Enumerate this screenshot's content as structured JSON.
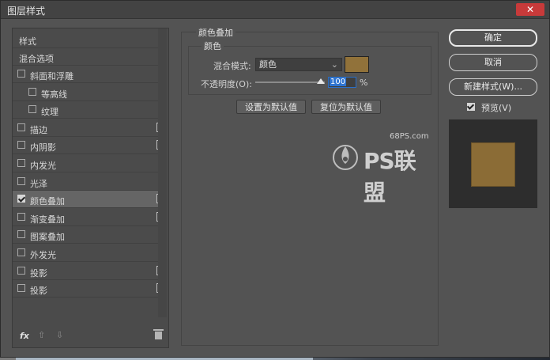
{
  "window": {
    "title": "图层样式",
    "close_glyph": "✕"
  },
  "styles_list": {
    "header": "样式",
    "blend_options": "混合选项",
    "items": [
      {
        "label": "斜面和浮雕",
        "checked": false,
        "indent": false,
        "plus": false
      },
      {
        "label": "等高线",
        "checked": false,
        "indent": true,
        "plus": false
      },
      {
        "label": "纹理",
        "checked": false,
        "indent": true,
        "plus": false
      },
      {
        "label": "描边",
        "checked": false,
        "indent": false,
        "plus": true
      },
      {
        "label": "内阴影",
        "checked": false,
        "indent": false,
        "plus": true
      },
      {
        "label": "内发光",
        "checked": false,
        "indent": false,
        "plus": false
      },
      {
        "label": "光泽",
        "checked": false,
        "indent": false,
        "plus": false
      },
      {
        "label": "颜色叠加",
        "checked": true,
        "indent": false,
        "plus": true,
        "selected": true
      },
      {
        "label": "渐变叠加",
        "checked": false,
        "indent": false,
        "plus": true
      },
      {
        "label": "图案叠加",
        "checked": false,
        "indent": false,
        "plus": false
      },
      {
        "label": "外发光",
        "checked": false,
        "indent": false,
        "plus": false
      },
      {
        "label": "投影",
        "checked": false,
        "indent": false,
        "plus": true
      },
      {
        "label": "投影",
        "checked": false,
        "indent": false,
        "plus": true
      }
    ],
    "fx_label": "fx",
    "up_arrow": "⇧",
    "down_arrow": "⇩"
  },
  "panel": {
    "group_title": "颜色叠加",
    "sub_title": "颜色",
    "blend_mode_label": "混合模式:",
    "blend_mode_value": "颜色",
    "overlay_color": "#91723a",
    "opacity_label": "不透明度(O):",
    "opacity_value": "100",
    "opacity_unit": "%",
    "set_default": "设置为默认值",
    "reset_default": "复位为默认值"
  },
  "actions": {
    "ok": "确定",
    "cancel": "取消",
    "new_style": "新建样式(W)...",
    "preview_label": "预览(V)",
    "preview_checked": true
  },
  "watermark": {
    "top": "68PS.com",
    "main": "PS联盟"
  }
}
